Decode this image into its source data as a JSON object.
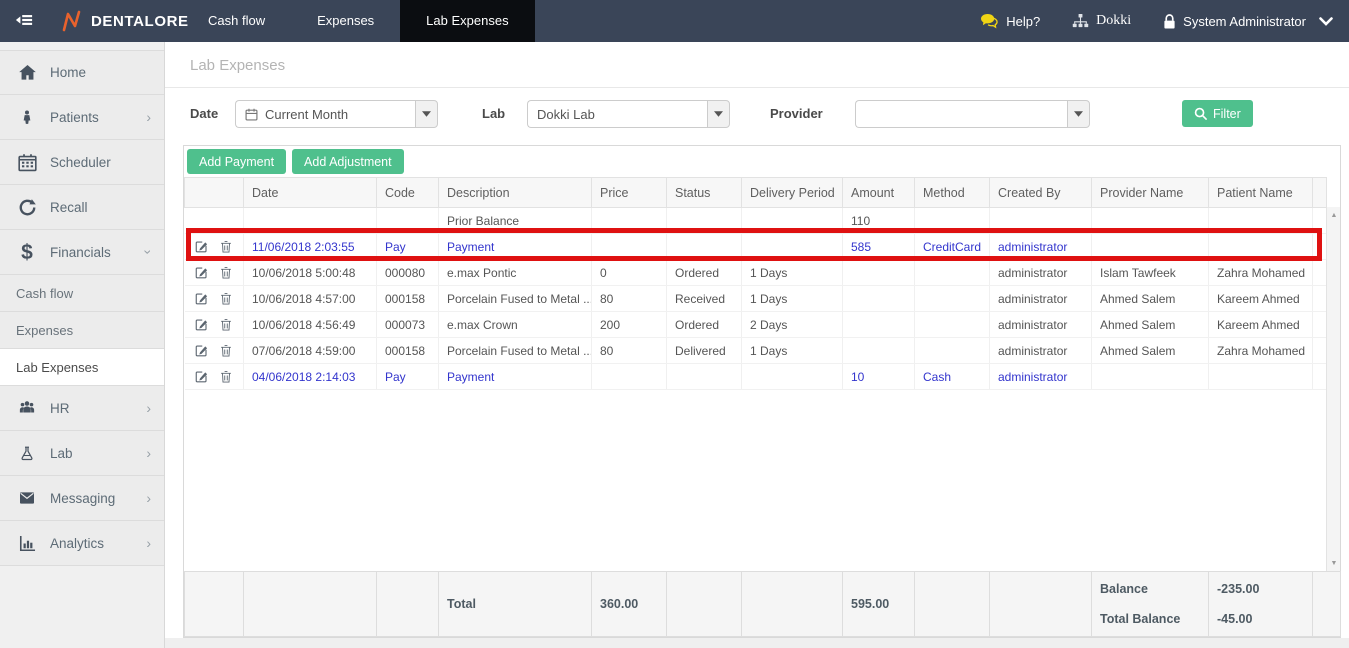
{
  "colors": {
    "accent_green": "#4fc08d",
    "brand_orange": "#e8622d",
    "payment_blue": "#3335cd",
    "highlight_red": "#df1111",
    "help_yellow": "#f0d414",
    "topbar_bg": "#3a4558"
  },
  "topbar": {
    "brand": "DENTALORE",
    "tabs": [
      {
        "label": "Cash flow"
      },
      {
        "label": "Expenses"
      },
      {
        "label": "Lab Expenses",
        "active": true
      }
    ],
    "help_label": "Help?",
    "clinic_name": "Dokki",
    "user_name": "System Administrator"
  },
  "sidebar": {
    "items": [
      {
        "label": "Home",
        "icon": "home"
      },
      {
        "label": "Patients",
        "icon": "patients",
        "chevron": "right"
      },
      {
        "label": "Scheduler",
        "icon": "scheduler"
      },
      {
        "label": "Recall",
        "icon": "recall"
      },
      {
        "label": "Financials",
        "icon": "financials",
        "chevron": "down"
      },
      {
        "label": "Cash flow",
        "sub": true
      },
      {
        "label": "Expenses",
        "sub": true
      },
      {
        "label": "Lab Expenses",
        "sub": true,
        "active": true
      },
      {
        "label": "HR",
        "icon": "hr",
        "chevron": "right"
      },
      {
        "label": "Lab",
        "icon": "lab",
        "chevron": "right"
      },
      {
        "label": "Messaging",
        "icon": "messaging",
        "chevron": "right"
      },
      {
        "label": "Analytics",
        "icon": "analytics",
        "chevron": "right"
      }
    ]
  },
  "page": {
    "title": "Lab Expenses"
  },
  "filters": {
    "date_label": "Date",
    "date_value": "Current Month",
    "lab_label": "Lab",
    "lab_value": "Dokki Lab",
    "provider_label": "Provider",
    "provider_value": "",
    "filter_button": "Filter"
  },
  "toolbar": {
    "add_payment": "Add Payment",
    "add_adjustment": "Add Adjustment"
  },
  "table": {
    "columns": [
      "",
      "Date",
      "Code",
      "Description",
      "Price",
      "Status",
      "Delivery Period",
      "Amount",
      "Method",
      "Created By",
      "Provider Name",
      "Patient Name"
    ],
    "rows": [
      {
        "date": "",
        "code": "",
        "description": "Prior Balance",
        "price": "",
        "status": "",
        "delivery_period": "",
        "amount": "110",
        "method": "",
        "created_by": "",
        "provider_name": "",
        "patient_name": "",
        "has_actions": false,
        "payment": false,
        "highlighted": false
      },
      {
        "date": "11/06/2018 2:03:55",
        "code": "Pay",
        "description": "Payment",
        "price": "",
        "status": "",
        "delivery_period": "",
        "amount": "585",
        "method": "CreditCard",
        "created_by": "administrator",
        "provider_name": "",
        "patient_name": "",
        "has_actions": true,
        "payment": true,
        "highlighted": true
      },
      {
        "date": "10/06/2018 5:00:48",
        "code": "000080",
        "description": "e.max Pontic",
        "price": "0",
        "status": "Ordered",
        "delivery_period": "1 Days",
        "amount": "",
        "method": "",
        "created_by": "administrator",
        "provider_name": "Islam Tawfeek",
        "patient_name": "Zahra Mohamed",
        "has_actions": true,
        "payment": false,
        "highlighted": false
      },
      {
        "date": "10/06/2018 4:57:00",
        "code": "000158",
        "description": "Porcelain Fused to Metal ...",
        "price": "80",
        "status": "Received",
        "delivery_period": "1 Days",
        "amount": "",
        "method": "",
        "created_by": "administrator",
        "provider_name": "Ahmed Salem",
        "patient_name": "Kareem Ahmed",
        "has_actions": true,
        "payment": false,
        "highlighted": false
      },
      {
        "date": "10/06/2018 4:56:49",
        "code": "000073",
        "description": "e.max Crown",
        "price": "200",
        "status": "Ordered",
        "delivery_period": "2 Days",
        "amount": "",
        "method": "",
        "created_by": "administrator",
        "provider_name": "Ahmed Salem",
        "patient_name": "Kareem Ahmed",
        "has_actions": true,
        "payment": false,
        "highlighted": false
      },
      {
        "date": "07/06/2018 4:59:00",
        "code": "000158",
        "description": "Porcelain Fused to Metal ...",
        "price": "80",
        "status": "Delivered",
        "delivery_period": "1 Days",
        "amount": "",
        "method": "",
        "created_by": "administrator",
        "provider_name": "Ahmed Salem",
        "patient_name": "Zahra Mohamed",
        "has_actions": true,
        "payment": false,
        "highlighted": false
      },
      {
        "date": "04/06/2018 2:14:03",
        "code": "Pay",
        "description": "Payment",
        "price": "",
        "status": "",
        "delivery_period": "",
        "amount": "10",
        "method": "Cash",
        "created_by": "administrator",
        "provider_name": "",
        "patient_name": "",
        "has_actions": true,
        "payment": true,
        "highlighted": false
      }
    ],
    "footer": {
      "total_label": "Total",
      "price_total": "360.00",
      "amount_total": "595.00",
      "balance_label": "Balance",
      "balance_value": "-235.00",
      "total_balance_label": "Total Balance",
      "total_balance_value": "-45.00"
    }
  }
}
